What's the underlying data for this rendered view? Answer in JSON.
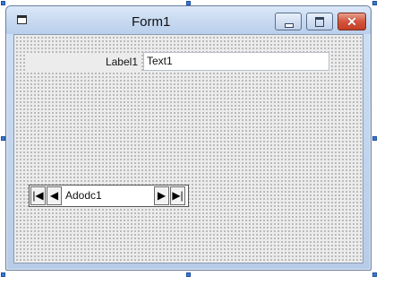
{
  "window": {
    "title": "Form1",
    "close_symbol": "✕"
  },
  "icons": {
    "app": "form-icon",
    "minimize": "minimize-icon",
    "maximize": "maximize-icon",
    "close": "close-icon",
    "first": "move-first-icon",
    "previous": "move-previous-icon",
    "next": "move-next-icon",
    "last": "move-last-icon"
  },
  "form": {
    "label1": "Label1",
    "text1": "Text1",
    "adodc": {
      "caption": "Adodc1",
      "first_symbol": "|◀",
      "prev_symbol": "◀",
      "next_symbol": "▶",
      "last_symbol": "▶|"
    }
  },
  "colors": {
    "close_button": "#c33f26",
    "selection_handle": "#3a78d6",
    "grid_dots": "#222222"
  }
}
